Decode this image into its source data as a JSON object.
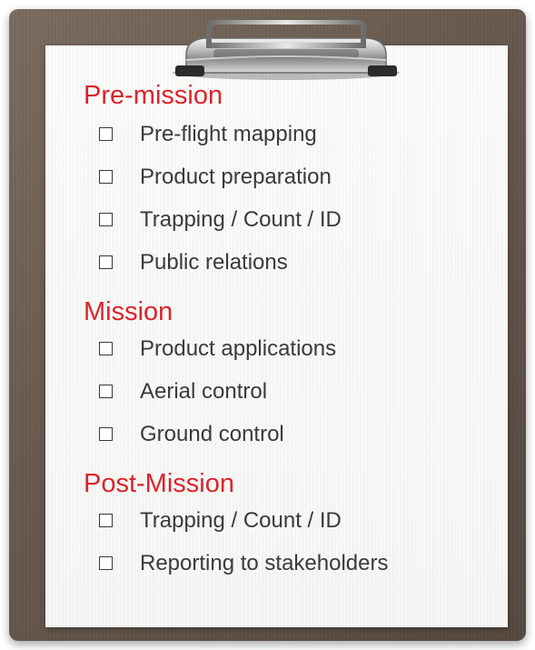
{
  "checklist": {
    "sections": [
      {
        "title": "Pre-mission",
        "items": [
          {
            "label": "Pre-flight mapping",
            "checked": false
          },
          {
            "label": "Product preparation",
            "checked": false
          },
          {
            "label": "Trapping / Count / ID",
            "checked": false
          },
          {
            "label": "Public relations",
            "checked": false
          }
        ]
      },
      {
        "title": "Mission",
        "items": [
          {
            "label": "Product applications",
            "checked": false
          },
          {
            "label": "Aerial control",
            "checked": false
          },
          {
            "label": "Ground control",
            "checked": false
          }
        ]
      },
      {
        "title": "Post-Mission",
        "items": [
          {
            "label": "Trapping / Count / ID",
            "checked": false
          },
          {
            "label": "Reporting to stakeholders",
            "checked": false
          }
        ]
      }
    ]
  },
  "colors": {
    "heading": "#d9252c",
    "text": "#3a3a3a",
    "board": "#6b5c50",
    "paper": "#f9f9f8"
  },
  "icons": {
    "clip": "clipboard-clip-icon",
    "checkbox": "empty-checkbox-icon"
  }
}
